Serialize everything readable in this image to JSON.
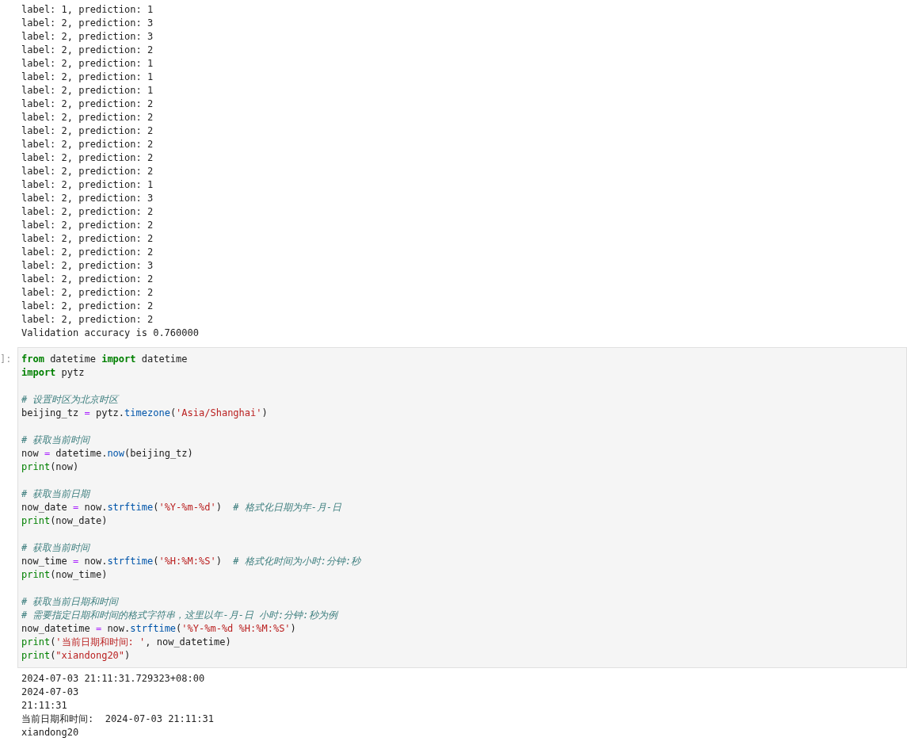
{
  "output_1": {
    "lines": [
      "label: 1, prediction: 1",
      "label: 2, prediction: 3",
      "label: 2, prediction: 3",
      "label: 2, prediction: 2",
      "label: 2, prediction: 1",
      "label: 2, prediction: 1",
      "label: 2, prediction: 1",
      "label: 2, prediction: 2",
      "label: 2, prediction: 2",
      "label: 2, prediction: 2",
      "label: 2, prediction: 2",
      "label: 2, prediction: 2",
      "label: 2, prediction: 2",
      "label: 2, prediction: 1",
      "label: 2, prediction: 3",
      "label: 2, prediction: 2",
      "label: 2, prediction: 2",
      "label: 2, prediction: 2",
      "label: 2, prediction: 2",
      "label: 2, prediction: 3",
      "label: 2, prediction: 2",
      "label: 2, prediction: 2",
      "label: 2, prediction: 2",
      "label: 2, prediction: 2",
      "Validation accuracy is 0.760000"
    ]
  },
  "code_cell": {
    "prompt": "]:",
    "lines": [
      {
        "tokens": [
          {
            "kind": "keyword",
            "text": "from"
          },
          {
            "kind": "plain",
            "text": " datetime "
          },
          {
            "kind": "keyword",
            "text": "import"
          },
          {
            "kind": "plain",
            "text": " datetime"
          }
        ]
      },
      {
        "tokens": [
          {
            "kind": "keyword",
            "text": "import"
          },
          {
            "kind": "plain",
            "text": " pytz"
          }
        ],
        "blank_after": true
      },
      {
        "tokens": [
          {
            "kind": "comment",
            "text": "# 设置时区为北京时区"
          }
        ]
      },
      {
        "tokens": [
          {
            "kind": "plain",
            "text": "beijing_tz "
          },
          {
            "kind": "operator",
            "text": "="
          },
          {
            "kind": "plain",
            "text": " pytz."
          },
          {
            "kind": "method",
            "text": "timezone"
          },
          {
            "kind": "plain",
            "text": "("
          },
          {
            "kind": "string",
            "text": "'Asia/Shanghai'"
          },
          {
            "kind": "plain",
            "text": ")"
          }
        ],
        "blank_after": true
      },
      {
        "tokens": [
          {
            "kind": "comment",
            "text": "# 获取当前时间"
          }
        ]
      },
      {
        "tokens": [
          {
            "kind": "plain",
            "text": "now "
          },
          {
            "kind": "operator",
            "text": "="
          },
          {
            "kind": "plain",
            "text": " datetime."
          },
          {
            "kind": "method",
            "text": "now"
          },
          {
            "kind": "plain",
            "text": "(beijing_tz)"
          }
        ]
      },
      {
        "tokens": [
          {
            "kind": "builtin",
            "text": "print"
          },
          {
            "kind": "plain",
            "text": "(now)"
          }
        ],
        "blank_after": true
      },
      {
        "tokens": [
          {
            "kind": "comment",
            "text": "# 获取当前日期"
          }
        ]
      },
      {
        "tokens": [
          {
            "kind": "plain",
            "text": "now_date "
          },
          {
            "kind": "operator",
            "text": "="
          },
          {
            "kind": "plain",
            "text": " now."
          },
          {
            "kind": "method",
            "text": "strftime"
          },
          {
            "kind": "plain",
            "text": "("
          },
          {
            "kind": "string",
            "text": "'%Y-%m-%d'"
          },
          {
            "kind": "plain",
            "text": ")  "
          },
          {
            "kind": "comment",
            "text": "# 格式化日期为年-月-日"
          }
        ]
      },
      {
        "tokens": [
          {
            "kind": "builtin",
            "text": "print"
          },
          {
            "kind": "plain",
            "text": "(now_date)"
          }
        ],
        "blank_after": true
      },
      {
        "tokens": [
          {
            "kind": "comment",
            "text": "# 获取当前时间"
          }
        ]
      },
      {
        "tokens": [
          {
            "kind": "plain",
            "text": "now_time "
          },
          {
            "kind": "operator",
            "text": "="
          },
          {
            "kind": "plain",
            "text": " now."
          },
          {
            "kind": "method",
            "text": "strftime"
          },
          {
            "kind": "plain",
            "text": "("
          },
          {
            "kind": "string",
            "text": "'%H:%M:%S'"
          },
          {
            "kind": "plain",
            "text": ")  "
          },
          {
            "kind": "comment",
            "text": "# 格式化时间为小时:分钟:秒"
          }
        ]
      },
      {
        "tokens": [
          {
            "kind": "builtin",
            "text": "print"
          },
          {
            "kind": "plain",
            "text": "(now_time)"
          }
        ],
        "blank_after": true
      },
      {
        "tokens": [
          {
            "kind": "comment",
            "text": "# 获取当前日期和时间"
          }
        ]
      },
      {
        "tokens": [
          {
            "kind": "comment",
            "text": "# 需要指定日期和时间的格式字符串，这里以年-月-日 小时:分钟:秒为例"
          }
        ]
      },
      {
        "tokens": [
          {
            "kind": "plain",
            "text": "now_datetime "
          },
          {
            "kind": "operator",
            "text": "="
          },
          {
            "kind": "plain",
            "text": " now."
          },
          {
            "kind": "method",
            "text": "strftime"
          },
          {
            "kind": "plain",
            "text": "("
          },
          {
            "kind": "string",
            "text": "'%Y-%m-%d %H:%M:%S'"
          },
          {
            "kind": "plain",
            "text": ")"
          }
        ]
      },
      {
        "tokens": [
          {
            "kind": "builtin",
            "text": "print"
          },
          {
            "kind": "plain",
            "text": "("
          },
          {
            "kind": "string",
            "text": "'当前日期和时间: '"
          },
          {
            "kind": "plain",
            "text": ", now_datetime)"
          }
        ]
      },
      {
        "tokens": [
          {
            "kind": "builtin",
            "text": "print"
          },
          {
            "kind": "plain",
            "text": "("
          },
          {
            "kind": "string",
            "text": "\"xiandong20\""
          },
          {
            "kind": "plain",
            "text": ")"
          }
        ]
      }
    ]
  },
  "output_2": {
    "lines": [
      "2024-07-03 21:11:31.729323+08:00",
      "2024-07-03",
      "21:11:31",
      "当前日期和时间:  2024-07-03 21:11:31",
      "xiandong20"
    ]
  }
}
